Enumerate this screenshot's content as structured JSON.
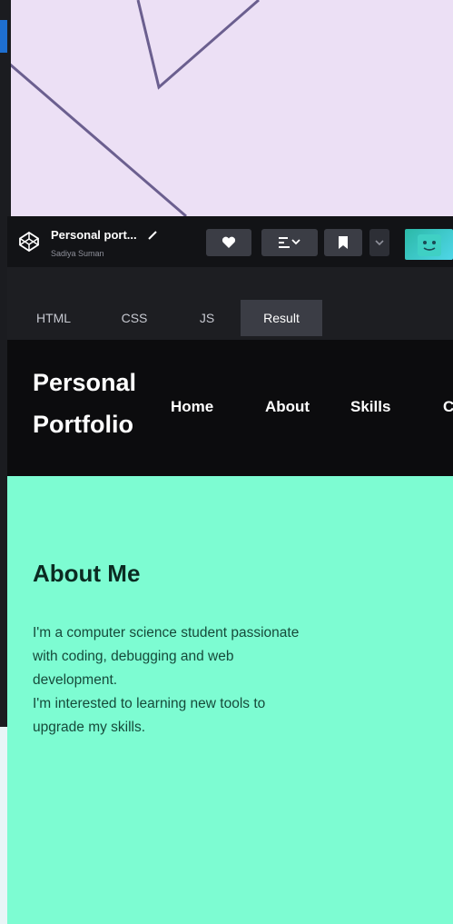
{
  "toolbar": {
    "title": "Personal port...",
    "author": "Sadiya Suman",
    "buttons": [
      "heart-icon",
      "layout-icon",
      "bookmark-icon",
      "chevron-down-icon"
    ]
  },
  "editor_tabs": [
    "HTML",
    "CSS",
    "JS",
    "Result"
  ],
  "site": {
    "brand_line1": "Personal",
    "brand_line2": "Portfolio",
    "nav": [
      "Home",
      "About",
      "Skills",
      "C"
    ]
  },
  "about": {
    "heading": "About Me",
    "lines": [
      "I'm a computer science student passionate",
      "with coding, debugging and web",
      "development.",
      "I'm interested to learning new tools to",
      "upgrade my skills."
    ]
  },
  "colors": {
    "about_bg": "#7dfcd2",
    "header_bg": "#0c0c0e",
    "page_bg": "#ece0f5"
  }
}
